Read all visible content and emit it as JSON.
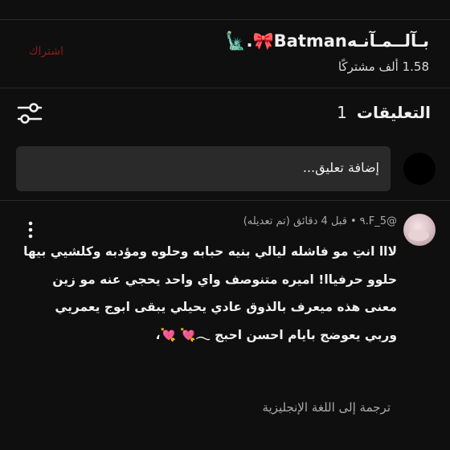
{
  "channel": {
    "name": "بـآلــمـآنـهBatman🎀.🗽",
    "subscribers": "1.58 ألف مشتركًا",
    "subscribe_label": "اشتراك"
  },
  "comments_section": {
    "title": "التعليقات",
    "count": "1",
    "filter_icon": "filter-sliders-icon"
  },
  "add_comment": {
    "placeholder": "إضافة تعليق..."
  },
  "comment": {
    "author": "@5_F.٩",
    "time": "قبل 4 دقائق (تم تعديله)",
    "separator": "•",
    "text": "لااا انتِ مو فاشله ليالي بنيه حبابه وحلوه ومؤدبه وكلشيي بيها حلوو حرفياا! اميره متنوصف واي واحد يحجي عنه مو زين معنى هذه ميعرف بالذوق عادي يحيلي يبقى ابوج يعمريي وربي يعوضج بايام احسن احبج 𓂃💘 💘،",
    "translate_label": "ترجمة إلى اللغة الإنجليزية",
    "more_icon": "more-vertical-icon"
  },
  "colors": {
    "background": "#0f0f0f",
    "input_background": "#2a2a2a",
    "subscribe": "#8e1b1b",
    "divider": "#2b2b2b"
  }
}
